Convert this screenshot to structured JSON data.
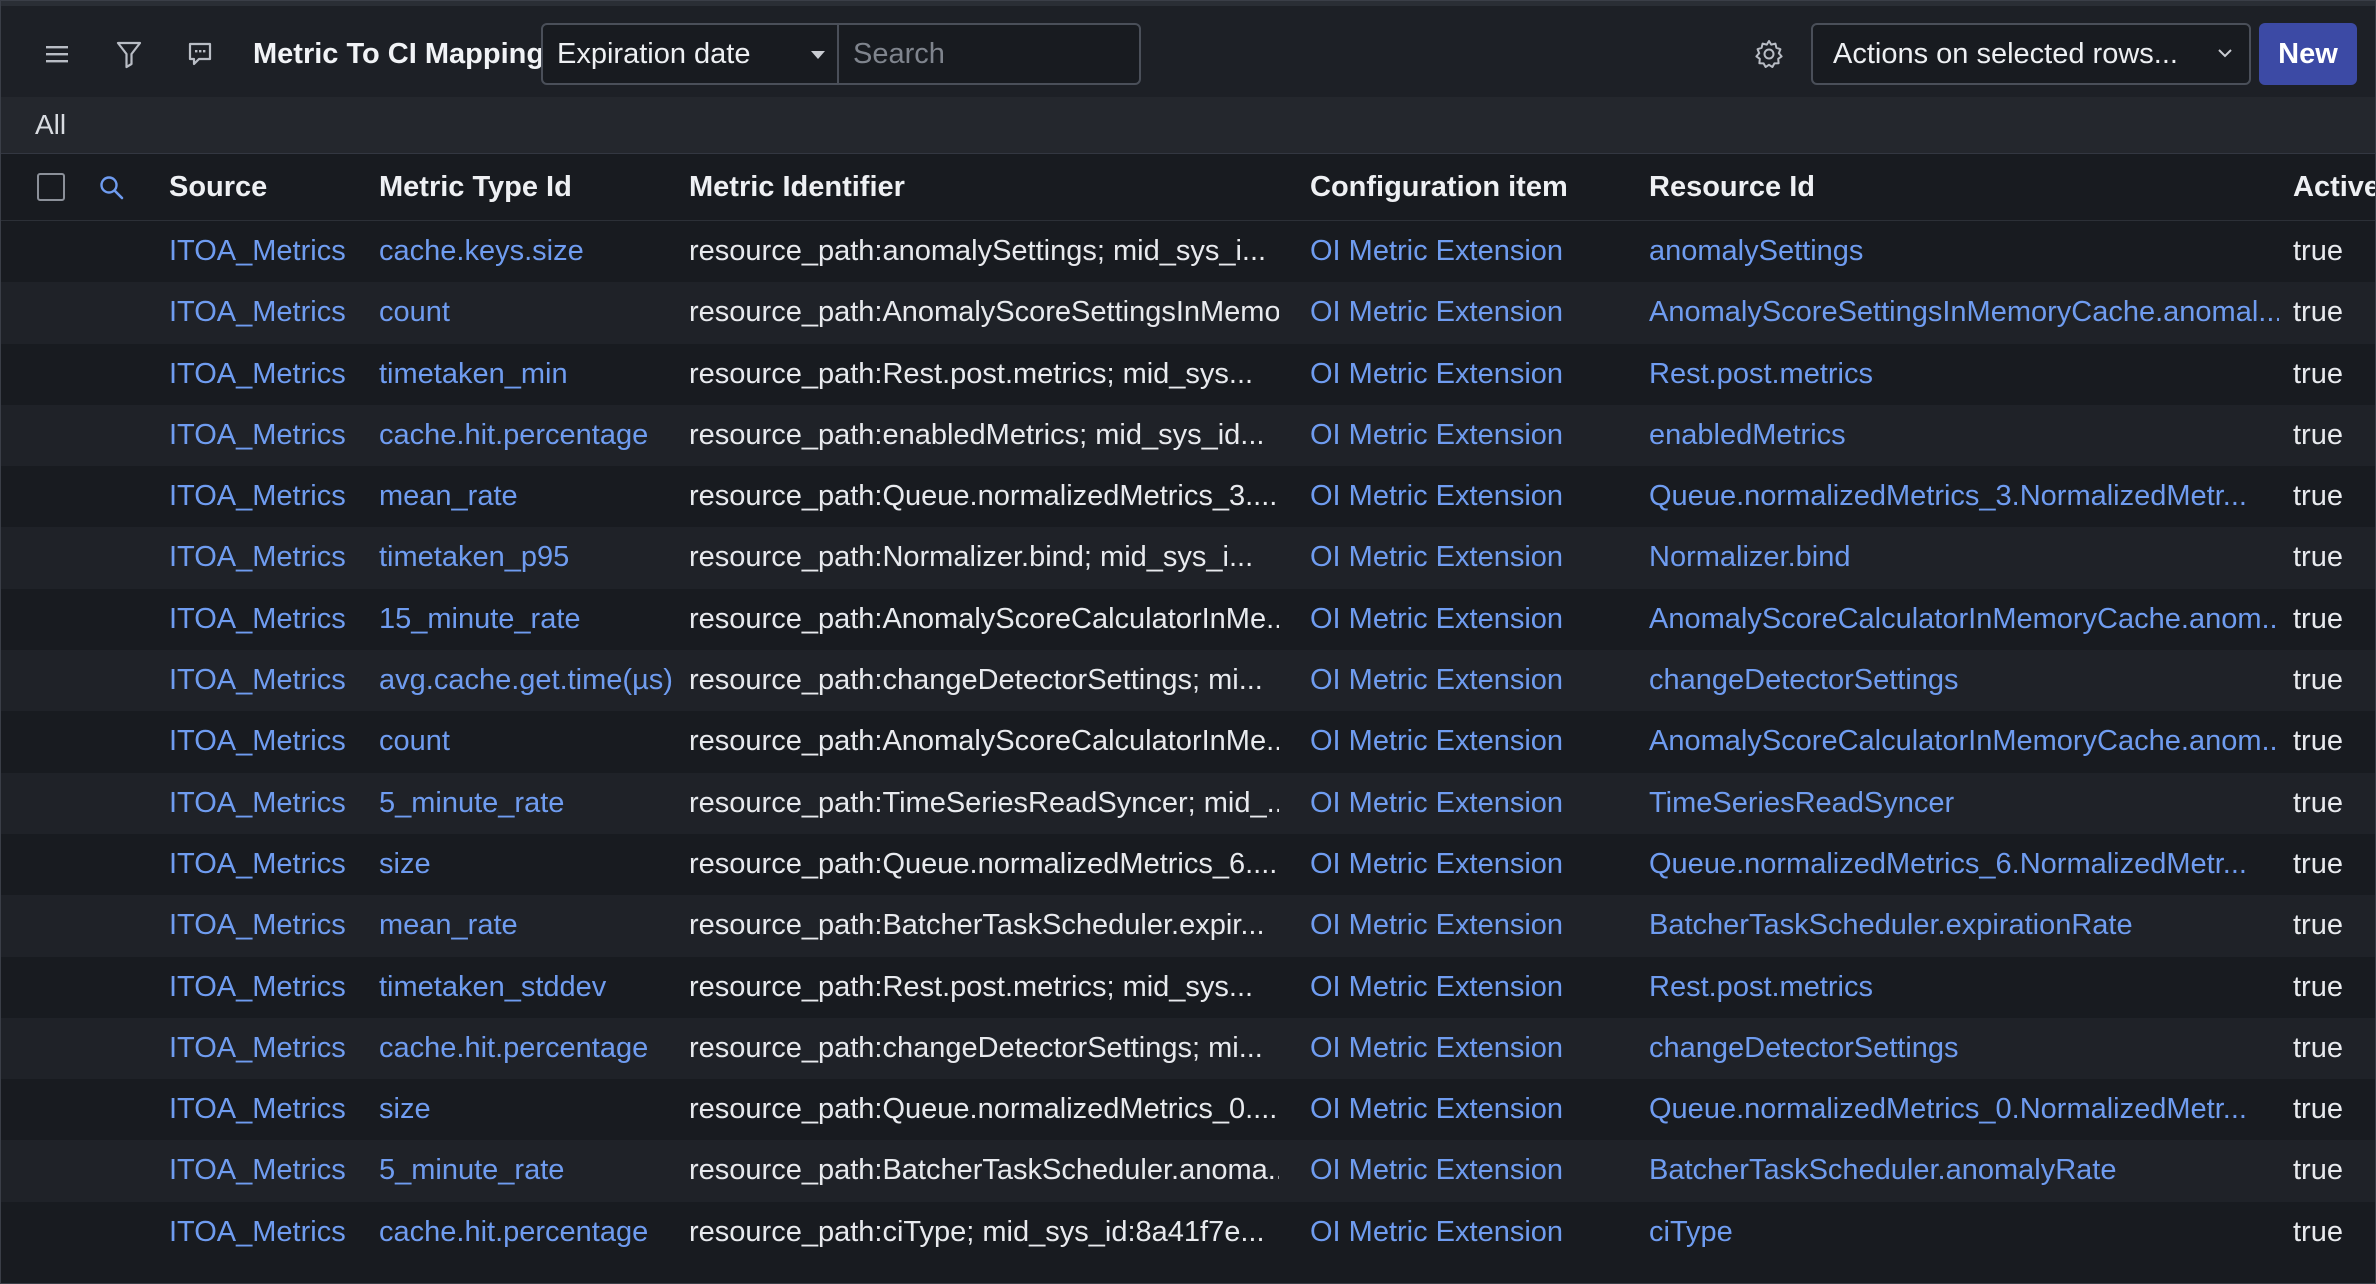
{
  "toolbar": {
    "title": "Metric To CI Mappings",
    "field_select": "Expiration date",
    "search_placeholder": "Search",
    "actions_label": "Actions on selected rows...",
    "new_label": "New",
    "icons": [
      "hamburger-menu-icon",
      "filter-icon",
      "chat-bubble-icon",
      "gear-icon"
    ],
    "accent_color": "#3c4aa5",
    "link_color": "#6f9cf0"
  },
  "filter": {
    "breadcrumb": "All"
  },
  "table": {
    "headers": {
      "source": "Source",
      "metric_type_id": "Metric Type Id",
      "metric_identifier": "Metric Identifier",
      "configuration_item": "Configuration item",
      "resource_id": "Resource Id",
      "active": "Active"
    },
    "rows": [
      {
        "source": "ITOA_Metrics",
        "metric_type_id": "cache.keys.size",
        "metric_identifier": "resource_path:anomalySettings; mid_sys_i...",
        "configuration_item": "OI Metric Extension",
        "resource_id": "anomalySettings",
        "active": "true"
      },
      {
        "source": "ITOA_Metrics",
        "metric_type_id": "count",
        "metric_identifier": "resource_path:AnomalyScoreSettingsInMemo...",
        "configuration_item": "OI Metric Extension",
        "resource_id": "AnomalyScoreSettingsInMemoryCache.anomal...",
        "active": "true"
      },
      {
        "source": "ITOA_Metrics",
        "metric_type_id": "timetaken_min",
        "metric_identifier": "resource_path:Rest.post.metrics; mid_sys...",
        "configuration_item": "OI Metric Extension",
        "resource_id": "Rest.post.metrics",
        "active": "true"
      },
      {
        "source": "ITOA_Metrics",
        "metric_type_id": "cache.hit.percentage",
        "metric_identifier": "resource_path:enabledMetrics; mid_sys_id...",
        "configuration_item": "OI Metric Extension",
        "resource_id": "enabledMetrics",
        "active": "true"
      },
      {
        "source": "ITOA_Metrics",
        "metric_type_id": "mean_rate",
        "metric_identifier": "resource_path:Queue.normalizedMetrics_3....",
        "configuration_item": "OI Metric Extension",
        "resource_id": "Queue.normalizedMetrics_3.NormalizedMetr...",
        "active": "true"
      },
      {
        "source": "ITOA_Metrics",
        "metric_type_id": "timetaken_p95",
        "metric_identifier": "resource_path:Normalizer.bind; mid_sys_i...",
        "configuration_item": "OI Metric Extension",
        "resource_id": "Normalizer.bind",
        "active": "true"
      },
      {
        "source": "ITOA_Metrics",
        "metric_type_id": "15_minute_rate",
        "metric_identifier": "resource_path:AnomalyScoreCalculatorInMe...",
        "configuration_item": "OI Metric Extension",
        "resource_id": "AnomalyScoreCalculatorInMemoryCache.anom...",
        "active": "true"
      },
      {
        "source": "ITOA_Metrics",
        "metric_type_id": "avg.cache.get.time(µs)",
        "metric_identifier": "resource_path:changeDetectorSettings; mi...",
        "configuration_item": "OI Metric Extension",
        "resource_id": "changeDetectorSettings",
        "active": "true"
      },
      {
        "source": "ITOA_Metrics",
        "metric_type_id": "count",
        "metric_identifier": "resource_path:AnomalyScoreCalculatorInMe...",
        "configuration_item": "OI Metric Extension",
        "resource_id": "AnomalyScoreCalculatorInMemoryCache.anom...",
        "active": "true"
      },
      {
        "source": "ITOA_Metrics",
        "metric_type_id": "5_minute_rate",
        "metric_identifier": "resource_path:TimeSeriesReadSyncer; mid_...",
        "configuration_item": "OI Metric Extension",
        "resource_id": "TimeSeriesReadSyncer",
        "active": "true"
      },
      {
        "source": "ITOA_Metrics",
        "metric_type_id": "size",
        "metric_identifier": "resource_path:Queue.normalizedMetrics_6....",
        "configuration_item": "OI Metric Extension",
        "resource_id": "Queue.normalizedMetrics_6.NormalizedMetr...",
        "active": "true"
      },
      {
        "source": "ITOA_Metrics",
        "metric_type_id": "mean_rate",
        "metric_identifier": "resource_path:BatcherTaskScheduler.expir...",
        "configuration_item": "OI Metric Extension",
        "resource_id": "BatcherTaskScheduler.expirationRate",
        "active": "true"
      },
      {
        "source": "ITOA_Metrics",
        "metric_type_id": "timetaken_stddev",
        "metric_identifier": "resource_path:Rest.post.metrics; mid_sys...",
        "configuration_item": "OI Metric Extension",
        "resource_id": "Rest.post.metrics",
        "active": "true"
      },
      {
        "source": "ITOA_Metrics",
        "metric_type_id": "cache.hit.percentage",
        "metric_identifier": "resource_path:changeDetectorSettings; mi...",
        "configuration_item": "OI Metric Extension",
        "resource_id": "changeDetectorSettings",
        "active": "true"
      },
      {
        "source": "ITOA_Metrics",
        "metric_type_id": "size",
        "metric_identifier": "resource_path:Queue.normalizedMetrics_0....",
        "configuration_item": "OI Metric Extension",
        "resource_id": "Queue.normalizedMetrics_0.NormalizedMetr...",
        "active": "true"
      },
      {
        "source": "ITOA_Metrics",
        "metric_type_id": "5_minute_rate",
        "metric_identifier": "resource_path:BatcherTaskScheduler.anoma...",
        "configuration_item": "OI Metric Extension",
        "resource_id": "BatcherTaskScheduler.anomalyRate",
        "active": "true"
      },
      {
        "source": "ITOA_Metrics",
        "metric_type_id": "cache.hit.percentage",
        "metric_identifier": "resource_path:ciType; mid_sys_id:8a41f7e...",
        "configuration_item": "OI Metric Extension",
        "resource_id": "ciType",
        "active": "true"
      }
    ]
  }
}
